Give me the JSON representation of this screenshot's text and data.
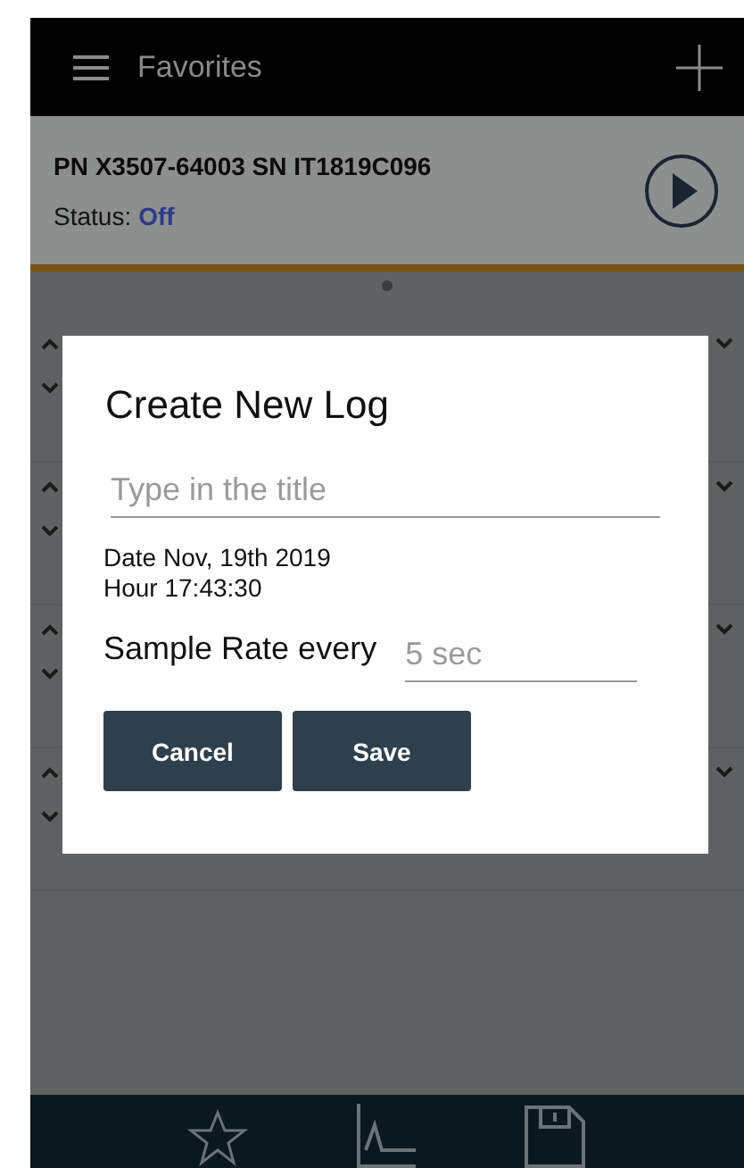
{
  "header": {
    "title": "Favorites"
  },
  "device": {
    "name": "PN X3507-64003 SN IT1819C096",
    "status_label": "Status:",
    "status_value": "Off"
  },
  "dialog": {
    "title": "Create New Log",
    "title_field": {
      "placeholder": "Type in the title"
    },
    "date": "Date Nov, 19th 2019",
    "hour": "Hour 17:43:30",
    "sample_rate_label": "Sample Rate every",
    "sample_rate_field": {
      "placeholder": "5 sec"
    },
    "buttons": [
      "Cancel",
      "Save"
    ]
  },
  "bottom_nav": [
    {
      "kind": "favorites"
    },
    {
      "kind": "chart"
    },
    {
      "kind": "save"
    }
  ]
}
